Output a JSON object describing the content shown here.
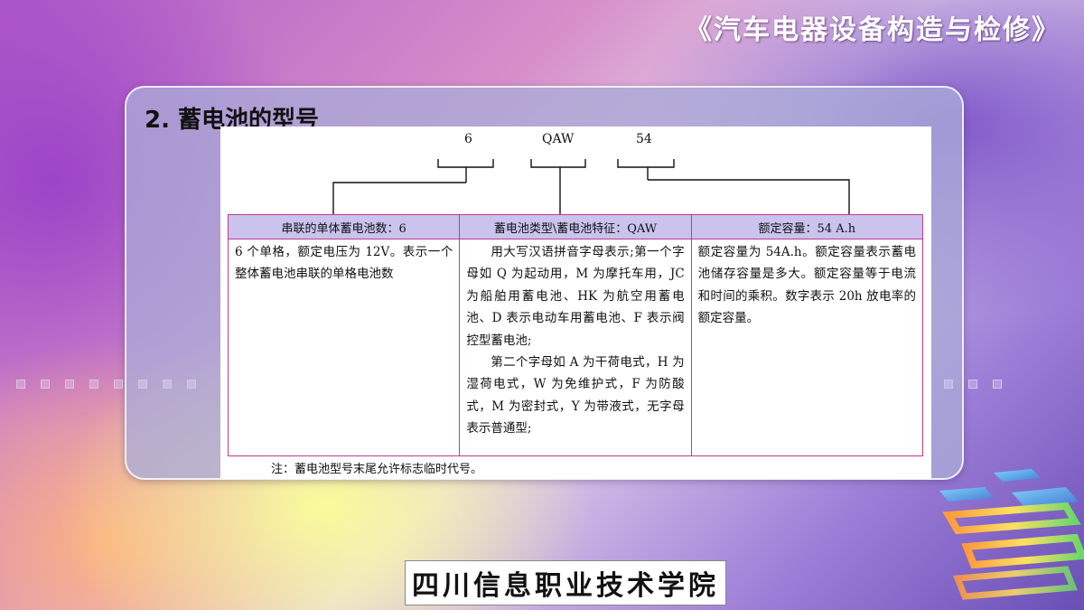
{
  "header": {
    "book_title": "《汽车电器设备构造与检修》"
  },
  "section": {
    "heading": "2.  蓄电池的型号"
  },
  "model_code": {
    "part1": "6",
    "part2": "QAW",
    "part3": "54"
  },
  "table": {
    "headers": [
      "串联的单体蓄电池数：6",
      "蓄电池类型\\蓄电池特征：QAW",
      "额定容量：54 A.h"
    ],
    "col1": "6 个单格，额定电压为 12V。表示一个整体蓄电池串联的单格电池数",
    "col2_para1": "用大写汉语拼音字母表示;第一个字母如 Q 为起动用，M 为摩托车用，JC 为船舶用蓄电池、HK 为航空用蓄电池、D 表示电动车用蓄电池、F 表示阀控型蓄电池;",
    "col2_para2": "第二个字母如 A 为干荷电式，H 为湿荷电式，W 为免维护式，F 为防酸式，M 为密封式，Y 为带液式，无字母表示普通型;",
    "col3": "额定容量为 54A.h。额定容量表示蓄电池储存容量是多大。额定容量等于电流和时间的乘积。数字表示 20h 放电率的额定容量。"
  },
  "note": "注：蓄电池型号末尾允许标志临时代号。",
  "logo_text": "四川信息职业技术学院"
}
